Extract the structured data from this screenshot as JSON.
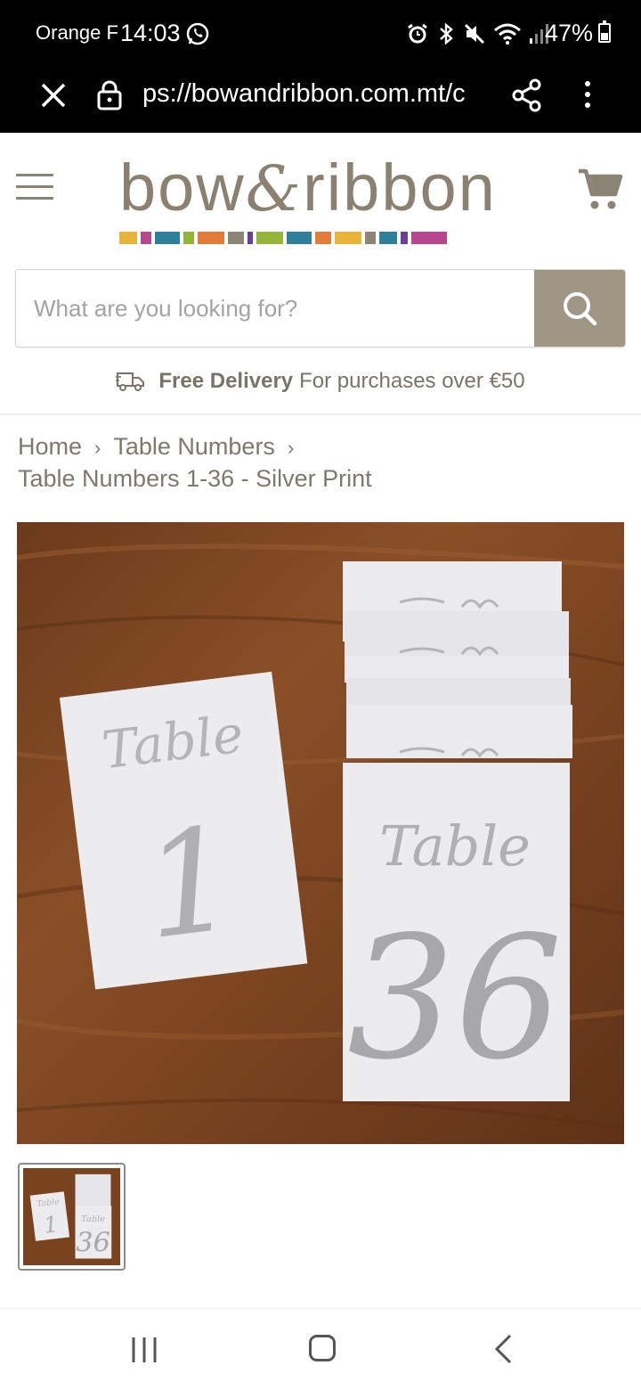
{
  "status_bar": {
    "carrier": "Orange F",
    "time": "14:03",
    "battery_percent": "47%",
    "battery_level": 0.47,
    "icons": [
      "whatsapp-icon",
      "alarm-icon",
      "bluetooth-icon",
      "mute-icon",
      "wifi-icon",
      "signal-icon",
      "battery-icon"
    ]
  },
  "browser": {
    "url": "ps://bowandribbon.com.mt/c",
    "close_icon": "close-icon",
    "lock_icon": "lock-icon",
    "share_icon": "share-icon",
    "menu_icon": "more-vert-icon"
  },
  "header": {
    "logo_text_1": "bow",
    "logo_amp": "&",
    "logo_text_2": "ribbon",
    "logo_stripe_colors": [
      "#e9b43a",
      "#b5488e",
      "#2f7f99",
      "#94b43b",
      "#e27c3a",
      "#8d8576",
      "#6b3f93",
      "#94b43b",
      "#2f7f99",
      "#e27c3a",
      "#e9b43a",
      "#8d8576",
      "#2f7f99",
      "#6b3f93",
      "#b5488e"
    ],
    "brand_color": "#9f9684"
  },
  "search": {
    "placeholder": "What are you looking for?",
    "value": ""
  },
  "delivery": {
    "strong": "Free Delivery",
    "text": "For purchases over €50"
  },
  "breadcrumb": {
    "items": [
      "Home",
      "Table Numbers"
    ],
    "current": "Table Numbers 1-36 - Silver Print"
  },
  "product": {
    "image_cards": [
      {
        "word": "Table",
        "number": "1"
      },
      {
        "word": "Table",
        "number": "36"
      }
    ]
  },
  "system_nav": {
    "icons": [
      "recent-apps-icon",
      "home-icon",
      "back-icon"
    ]
  }
}
